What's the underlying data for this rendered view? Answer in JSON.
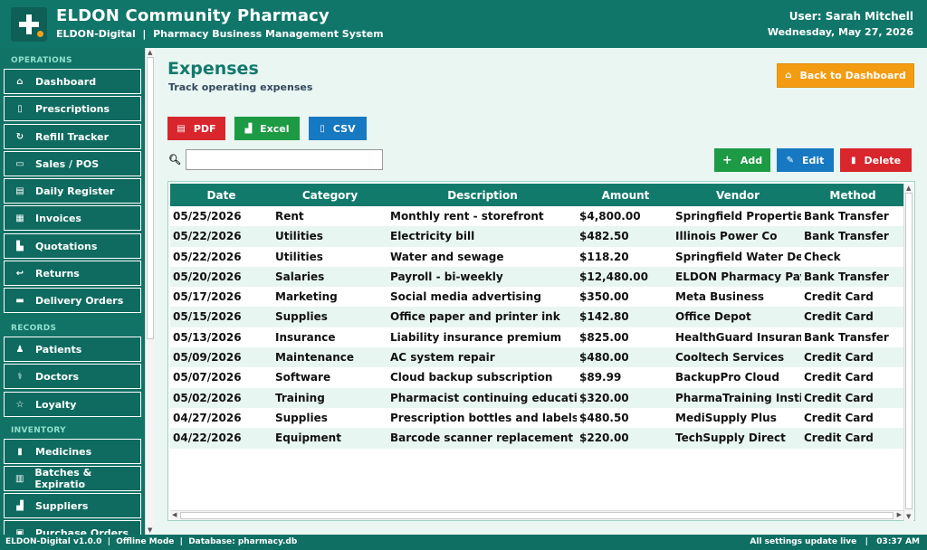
{
  "header": {
    "title": "ELDON Community Pharmacy",
    "subtitle": "ELDON-Digital  |  Pharmacy Business Management System",
    "user": "User: Sarah Mitchell",
    "date": "Wednesday, May 27, 2026"
  },
  "sidebar": {
    "sections": {
      "operations": "OPERATIONS",
      "records": "RECORDS",
      "inventory": "INVENTORY"
    },
    "items": [
      {
        "label": "Dashboard",
        "icon": "home-icon",
        "glyph": "⌂"
      },
      {
        "label": "Prescriptions",
        "icon": "clipboard-icon",
        "glyph": "▯"
      },
      {
        "label": "Refill Tracker",
        "icon": "refresh-icon",
        "glyph": "↻"
      },
      {
        "label": "Sales / POS",
        "icon": "card-icon",
        "glyph": "▭"
      },
      {
        "label": "Daily Register",
        "icon": "register-icon",
        "glyph": "▤"
      },
      {
        "label": "Invoices",
        "icon": "invoice-icon",
        "glyph": "▦"
      },
      {
        "label": "Quotations",
        "icon": "quote-icon",
        "glyph": "▙"
      },
      {
        "label": "Returns",
        "icon": "return-icon",
        "glyph": "↩"
      },
      {
        "label": "Delivery Orders",
        "icon": "truck-icon",
        "glyph": "▬"
      },
      {
        "label": "Patients",
        "icon": "patients-icon",
        "glyph": "♟"
      },
      {
        "label": "Doctors",
        "icon": "stethoscope-icon",
        "glyph": "⚕"
      },
      {
        "label": "Loyalty",
        "icon": "star-icon",
        "glyph": "☆"
      },
      {
        "label": "Medicines",
        "icon": "pill-icon",
        "glyph": "▮"
      },
      {
        "label": "Batches & Expiratio",
        "icon": "batch-icon",
        "glyph": "▥"
      },
      {
        "label": "Suppliers",
        "icon": "factory-icon",
        "glyph": "▟"
      },
      {
        "label": "Purchase Orders",
        "icon": "cart-icon",
        "glyph": "▣"
      }
    ]
  },
  "main": {
    "title": "Expenses",
    "subtitle": "Track operating expenses",
    "back_button": "Back to Dashboard",
    "export": {
      "pdf": "PDF",
      "excel": "Excel",
      "csv": "CSV"
    },
    "actions": {
      "add": "Add",
      "edit": "Edit",
      "delete": "Delete"
    },
    "search": {
      "value": "",
      "placeholder": ""
    }
  },
  "table": {
    "columns": [
      "Date",
      "Category",
      "Description",
      "Amount",
      "Vendor",
      "Method"
    ],
    "rows": [
      [
        "05/25/2026",
        "Rent",
        "Monthly rent - storefront",
        "$4,800.00",
        "Springfield Properties",
        "Bank Transfer"
      ],
      [
        "05/22/2026",
        "Utilities",
        "Electricity bill",
        "$482.50",
        "Illinois Power Co",
        "Bank Transfer"
      ],
      [
        "05/22/2026",
        "Utilities",
        "Water and sewage",
        "$118.20",
        "Springfield Water Dept",
        "Check"
      ],
      [
        "05/20/2026",
        "Salaries",
        "Payroll - bi-weekly",
        "$12,480.00",
        "ELDON Pharmacy Payroll",
        "Bank Transfer"
      ],
      [
        "05/17/2026",
        "Marketing",
        "Social media advertising",
        "$350.00",
        "Meta Business",
        "Credit Card"
      ],
      [
        "05/15/2026",
        "Supplies",
        "Office paper and printer ink",
        "$142.80",
        "Office Depot",
        "Credit Card"
      ],
      [
        "05/13/2026",
        "Insurance",
        "Liability insurance premium",
        "$825.00",
        "HealthGuard Insurance",
        "Bank Transfer"
      ],
      [
        "05/09/2026",
        "Maintenance",
        "AC system repair",
        "$480.00",
        "Cooltech Services",
        "Credit Card"
      ],
      [
        "05/07/2026",
        "Software",
        "Cloud backup subscription",
        "$89.99",
        "BackupPro Cloud",
        "Credit Card"
      ],
      [
        "05/02/2026",
        "Training",
        "Pharmacist continuing education",
        "$320.00",
        "PharmaTraining Institute",
        "Credit Card"
      ],
      [
        "04/27/2026",
        "Supplies",
        "Prescription bottles and labels",
        "$480.50",
        "MediSupply Plus",
        "Credit Card"
      ],
      [
        "04/22/2026",
        "Equipment",
        "Barcode scanner replacement",
        "$220.00",
        "TechSupply Direct",
        "Credit Card"
      ]
    ]
  },
  "status": {
    "left": "ELDON-Digital v1.0.0  |  Offline Mode  |  Database: pharmacy.db",
    "right": "All settings update live   |   03:37 AM"
  },
  "colors": {
    "primary": "#11766a",
    "accent": "#f39c12",
    "danger": "#d9262c",
    "success": "#1d9a44",
    "info": "#1679c2"
  }
}
